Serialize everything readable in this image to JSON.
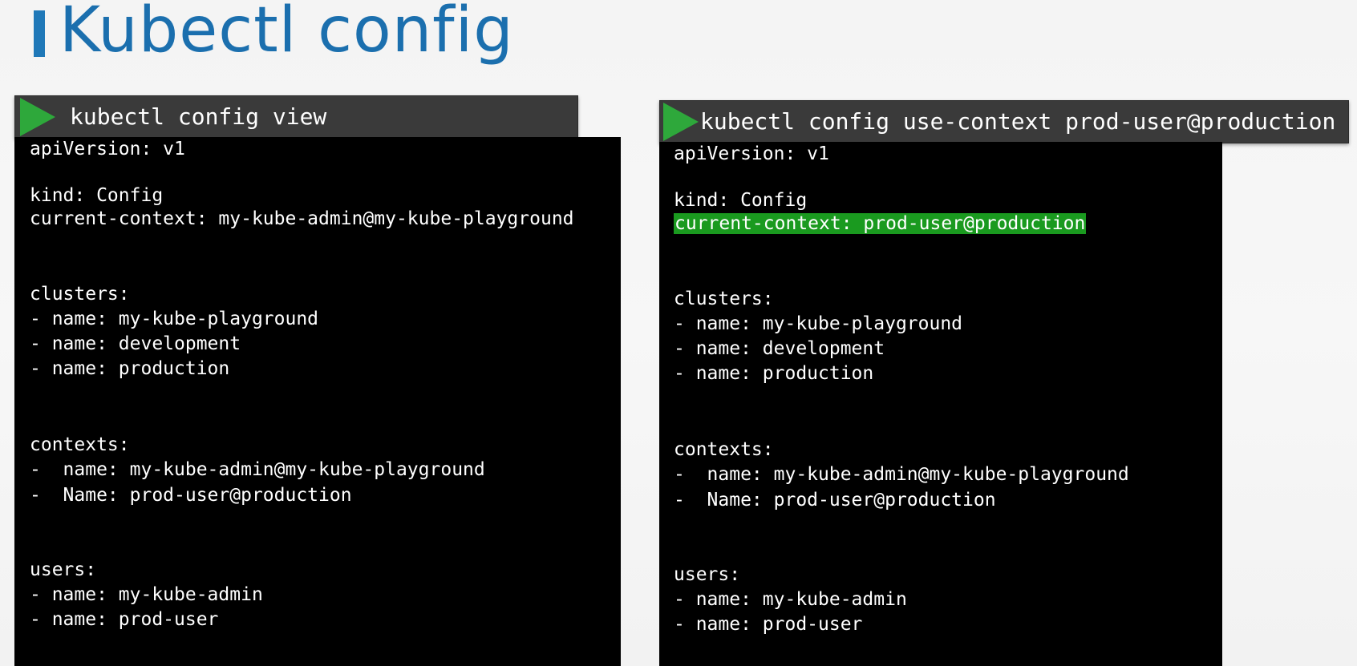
{
  "title": "Kubectl config",
  "left": {
    "command": "kubectl config view",
    "output": [
      "apiVersion: v1",
      "kind: Config",
      "current-context: my-kube-admin@my-kube-playground",
      "clusters:",
      "- name: my-kube-playground",
      "- name: development",
      "- name: production",
      "contexts:",
      "-  name: my-kube-admin@my-kube-playground",
      "-  Name: prod-user@production",
      "users:",
      "- name: my-kube-admin",
      "- name: prod-user"
    ]
  },
  "right": {
    "command": "kubectl config use-context prod-user@production",
    "output": [
      "apiVersion: v1",
      "kind: Config",
      "current-context: prod-user@production",
      "clusters:",
      "- name: my-kube-playground",
      "- name: development",
      "- name: production",
      "contexts:",
      "-  name: my-kube-admin@my-kube-playground",
      "-  Name: prod-user@production",
      "users:",
      "- name: my-kube-admin",
      "- name: prod-user"
    ],
    "highlight_color": "#1a9a1f"
  },
  "colors": {
    "title": "#1b6fae",
    "play_icon": "#2ea83b",
    "terminal_bg": "#000000",
    "command_bar_bg": "#3a3a3a"
  },
  "icons": {
    "play": "play-icon"
  }
}
